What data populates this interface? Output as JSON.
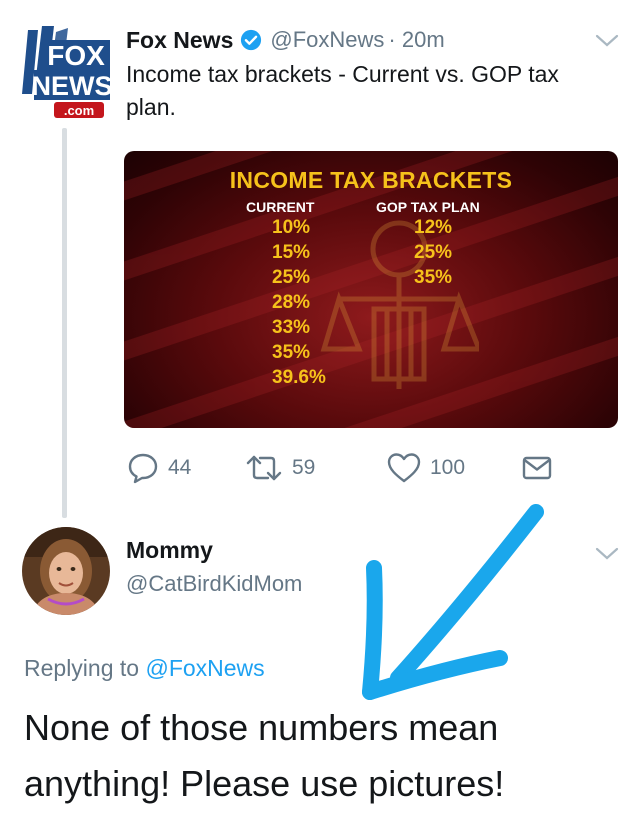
{
  "tweet": {
    "author_name": "Fox News",
    "author_handle": "@FoxNews",
    "time": "· 20m",
    "text": "Income tax brackets - Current vs. GOP tax plan.",
    "avatar_logo": {
      "line1": "FOX",
      "line2": "NEWS",
      "line3": ".com"
    },
    "media": {
      "title": "INCOME TAX BRACKETS",
      "current_label": "CURRENT",
      "gop_label": "GOP TAX PLAN",
      "current_rates": [
        "10%",
        "15%",
        "25%",
        "28%",
        "33%",
        "35%",
        "39.6%"
      ],
      "gop_rates": [
        "12%",
        "25%",
        "35%"
      ]
    },
    "actions": {
      "replies": "44",
      "retweets": "59",
      "likes": "100"
    }
  },
  "reply": {
    "author_name": "Mommy",
    "author_handle": "@CatBirdKidMom",
    "replying_prefix": "Replying to",
    "replying_to": "@FoxNews",
    "text": "None of those numbers mean anything! Please use pictures!"
  },
  "colors": {
    "link_blue": "#1da1f2",
    "gray_text": "#657786",
    "arrow_blue": "#1aa7ec",
    "graphic_gold": "#f6c21b"
  },
  "icons": [
    "reply-icon",
    "retweet-icon",
    "like-icon",
    "dm-icon",
    "verified-icon",
    "chevron-down-icon",
    "arrow-annotation"
  ]
}
